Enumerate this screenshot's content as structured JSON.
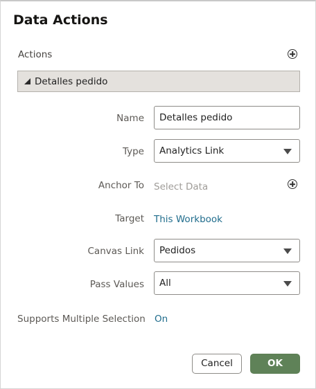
{
  "dialog": {
    "title": "Data Actions",
    "actions_label": "Actions",
    "action_item": "Detalles pedido"
  },
  "form": {
    "name_label": "Name",
    "name_value": "Detalles pedido",
    "type_label": "Type",
    "type_value": "Analytics Link",
    "anchor_label": "Anchor To",
    "anchor_placeholder": "Select Data",
    "target_label": "Target",
    "target_value": "This Workbook",
    "canvas_label": "Canvas Link",
    "canvas_value": "Pedidos",
    "pass_label": "Pass Values",
    "pass_value": "All",
    "multi_label": "Supports Multiple Selection",
    "multi_value": "On"
  },
  "buttons": {
    "cancel": "Cancel",
    "ok": "OK"
  },
  "colors": {
    "accent_link": "#1f6c8c",
    "ok_button": "#5f8258",
    "list_item_bg": "#e4e1dd"
  },
  "icons": [
    "add-action-icon",
    "add-anchor-icon",
    "expand-triangle-icon",
    "dropdown-caret-icon"
  ]
}
